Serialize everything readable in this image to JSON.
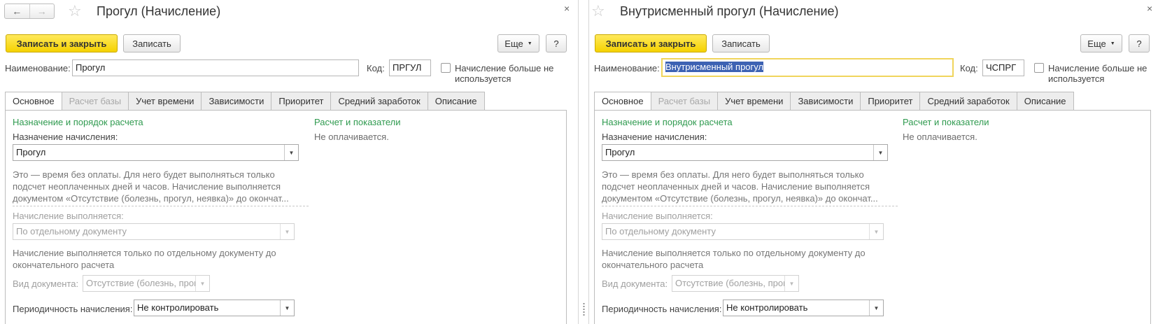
{
  "shared": {
    "save_close": "Записать и закрыть",
    "save": "Записать",
    "more": "Еще",
    "help": "?",
    "name_label": "Наименование:",
    "code_label": "Код:",
    "not_used_label_1": "Начисление больше не",
    "not_used_label_2": "используется",
    "tabs": [
      "Основное",
      "Расчет базы",
      "Учет времени",
      "Зависимости",
      "Приоритет",
      "Средний заработок",
      "Описание"
    ],
    "section_purpose": "Назначение и порядок расчета",
    "purpose_label": "Назначение начисления:",
    "purpose_value": "Прогул",
    "description_1": "Это — время без оплаты. Для него будет выполняться только",
    "description_2": "подсчет неоплаченных дней и часов. Начисление выполняется",
    "description_3": "документом «Отсутствие (болезнь, прогул, неявка)» до окончат...",
    "executed_label": "Начисление выполняется:",
    "executed_value": "По отдельному документу",
    "executed_note_1": "Начисление выполняется только по отдельному документу до",
    "executed_note_2": "окончательного расчета",
    "doc_type_label": "Вид документа:",
    "doc_type_value": "Отсутствие (болезнь, прог",
    "periodicity_label": "Периодичность начисления:",
    "periodicity_value": "Не контролировать",
    "section_calc": "Расчет и показатели",
    "calc_value": "Не оплачивается."
  },
  "left": {
    "title": "Прогул (Начисление)",
    "name_value": "Прогул",
    "code_value": "ПРГУЛ"
  },
  "right": {
    "title": "Внутрисменный прогул (Начисление)",
    "name_value": "Внутрисменный прогул",
    "code_value": "ЧСПРГ"
  },
  "icons": {
    "back": "←",
    "forward": "→",
    "star": "☆",
    "close": "×",
    "dropdown": "▼"
  }
}
